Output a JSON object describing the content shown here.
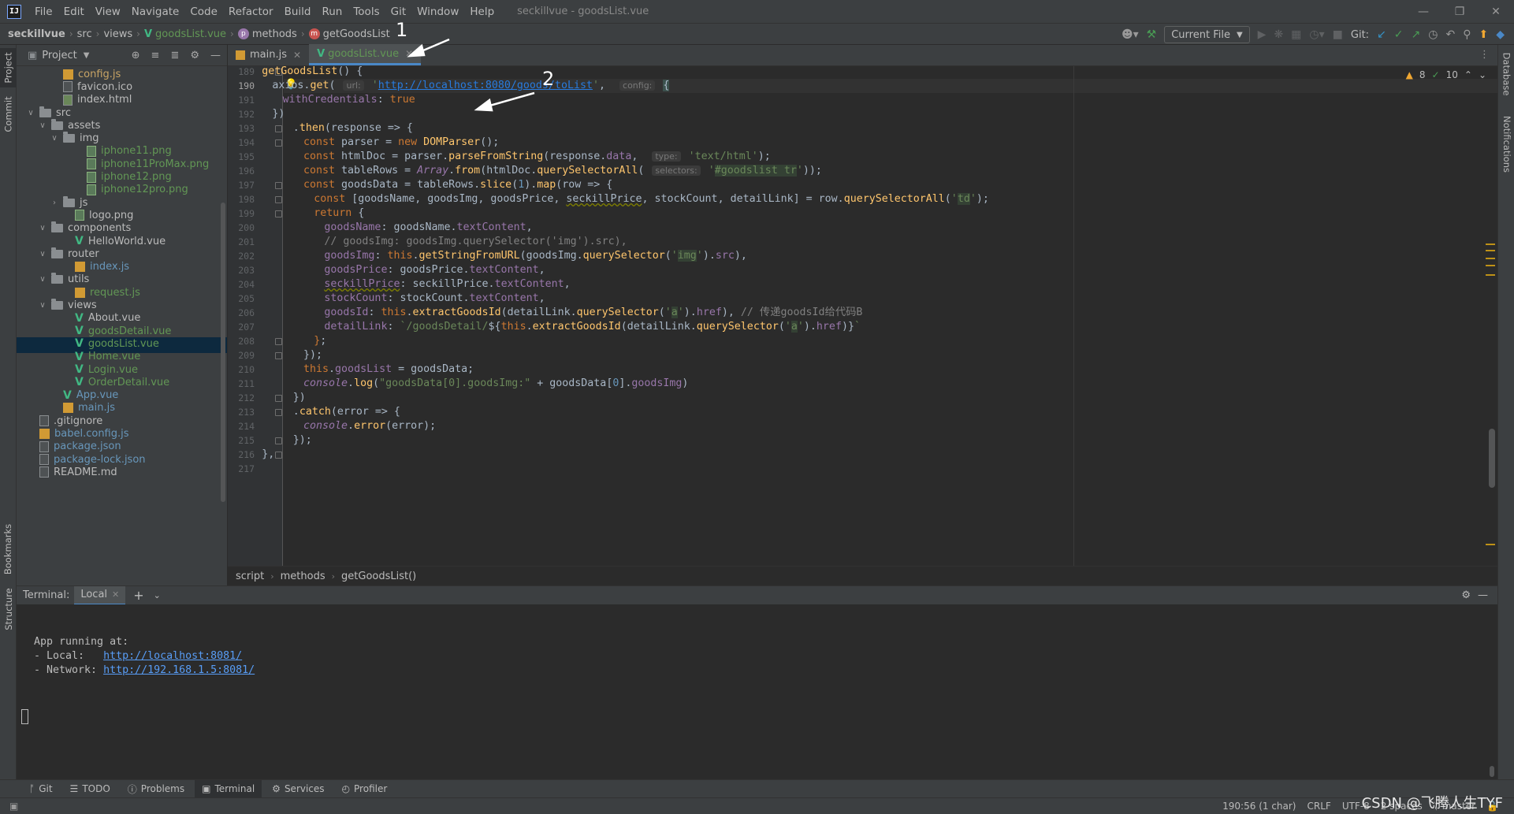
{
  "app": {
    "logo": "IJ",
    "menu": [
      "File",
      "Edit",
      "View",
      "Navigate",
      "Code",
      "Refactor",
      "Build",
      "Run",
      "Tools",
      "Git",
      "Window",
      "Help"
    ],
    "window_title": "seckillvue - goodsList.vue"
  },
  "breadcrumb": {
    "project": "seckillvue",
    "path": [
      "src",
      "views"
    ],
    "file": "goodsList.vue",
    "methods": "methods",
    "method": "getGoodsList"
  },
  "toolbar": {
    "run_config": "Current File",
    "git_label": "Git:"
  },
  "project_panel": {
    "title": "Project",
    "tree": [
      {
        "name": "config.js",
        "icon": "js-file-icon",
        "depth": 3,
        "style": "ignored"
      },
      {
        "name": "favicon.ico",
        "icon": "file-icon",
        "depth": 3,
        "style": "default"
      },
      {
        "name": "index.html",
        "icon": "html-file-icon",
        "depth": 3,
        "style": "default"
      },
      {
        "name": "src",
        "icon": "folder-icon",
        "depth": 1,
        "arrow": "v",
        "style": "default"
      },
      {
        "name": "assets",
        "icon": "folder-icon",
        "depth": 2,
        "arrow": "v",
        "style": "default"
      },
      {
        "name": "img",
        "icon": "folder-icon",
        "depth": 3,
        "arrow": "v",
        "style": "default"
      },
      {
        "name": "iphone11.png",
        "icon": "image-icon",
        "depth": 5,
        "style": "new"
      },
      {
        "name": "iphone11ProMax.png",
        "icon": "image-icon",
        "depth": 5,
        "style": "new"
      },
      {
        "name": "iphone12.png",
        "icon": "image-icon",
        "depth": 5,
        "style": "new"
      },
      {
        "name": "iphone12pro.png",
        "icon": "image-icon",
        "depth": 5,
        "style": "new"
      },
      {
        "name": "js",
        "icon": "folder-icon",
        "depth": 3,
        "arrow": ">",
        "style": "default"
      },
      {
        "name": "logo.png",
        "icon": "image-icon",
        "depth": 4,
        "style": "default"
      },
      {
        "name": "components",
        "icon": "folder-icon",
        "depth": 2,
        "arrow": "v",
        "style": "default"
      },
      {
        "name": "HelloWorld.vue",
        "icon": "vue-icon",
        "depth": 4,
        "style": "default"
      },
      {
        "name": "router",
        "icon": "folder-icon",
        "depth": 2,
        "arrow": "v",
        "style": "default"
      },
      {
        "name": "index.js",
        "icon": "js-file-icon",
        "depth": 4,
        "style": "mod"
      },
      {
        "name": "utils",
        "icon": "folder-icon",
        "depth": 2,
        "arrow": "v",
        "style": "default"
      },
      {
        "name": "request.js",
        "icon": "js-file-icon",
        "depth": 4,
        "style": "new"
      },
      {
        "name": "views",
        "icon": "folder-icon",
        "depth": 2,
        "arrow": "v",
        "style": "default"
      },
      {
        "name": "About.vue",
        "icon": "vue-icon",
        "depth": 4,
        "style": "default"
      },
      {
        "name": "goodsDetail.vue",
        "icon": "vue-icon",
        "depth": 4,
        "style": "new"
      },
      {
        "name": "goodsList.vue",
        "icon": "vue-icon",
        "depth": 4,
        "style": "new",
        "selected": true
      },
      {
        "name": "Home.vue",
        "icon": "vue-icon",
        "depth": 4,
        "style": "new"
      },
      {
        "name": "Login.vue",
        "icon": "vue-icon",
        "depth": 4,
        "style": "new"
      },
      {
        "name": "OrderDetail.vue",
        "icon": "vue-icon",
        "depth": 4,
        "style": "new"
      },
      {
        "name": "App.vue",
        "icon": "vue-icon",
        "depth": 3,
        "style": "mod"
      },
      {
        "name": "main.js",
        "icon": "js-file-icon",
        "depth": 3,
        "style": "mod"
      },
      {
        "name": ".gitignore",
        "icon": "file-icon",
        "depth": 1,
        "style": "default"
      },
      {
        "name": "babel.config.js",
        "icon": "js-file-icon",
        "depth": 1,
        "style": "mod"
      },
      {
        "name": "package.json",
        "icon": "file-icon",
        "depth": 1,
        "style": "mod"
      },
      {
        "name": "package-lock.json",
        "icon": "file-icon",
        "depth": 1,
        "style": "mod"
      },
      {
        "name": "README.md",
        "icon": "file-icon",
        "depth": 1,
        "style": "default"
      }
    ]
  },
  "left_strip": {
    "project": "Project",
    "commit": "Commit",
    "bookmarks": "Bookmarks",
    "structure": "Structure"
  },
  "right_strip": {
    "database": "Database",
    "notifications": "Notifications"
  },
  "editor_tabs": [
    {
      "label": "main.js",
      "icon": "js-file-icon",
      "active": false
    },
    {
      "label": "goodsList.vue",
      "icon": "vue-icon",
      "active": true
    }
  ],
  "editor": {
    "first_line": 189,
    "current_line": 190,
    "inspections": {
      "warnings": "8",
      "weak_warnings": "10"
    },
    "breadcrumb": [
      "script",
      "methods",
      "getGoodsList()"
    ]
  },
  "terminal": {
    "title": "Terminal:",
    "tab": "Local",
    "lines": [
      {
        "text": "App running at:"
      },
      {
        "text": "- Local:   ",
        "link": "http://localhost:8081/"
      },
      {
        "text": "- Network: ",
        "link": "http://192.168.1.5:8081/"
      }
    ]
  },
  "bottom_tools": [
    {
      "label": "Git",
      "icon": "git-branch-icon"
    },
    {
      "label": "TODO",
      "icon": "list-icon"
    },
    {
      "label": "Problems",
      "icon": "info-icon"
    },
    {
      "label": "Terminal",
      "icon": "terminal-icon",
      "active": true
    },
    {
      "label": "Services",
      "icon": "services-icon"
    },
    {
      "label": "Profiler",
      "icon": "profiler-icon"
    }
  ],
  "status": {
    "position": "190:56 (1 char)",
    "line_sep": "CRLF",
    "encoding": "UTF-8",
    "indent": "2 spaces",
    "branch": "master"
  },
  "annotations": {
    "one": "1",
    "two": "2"
  },
  "watermark": "CSDN @飞腾人生TYF"
}
